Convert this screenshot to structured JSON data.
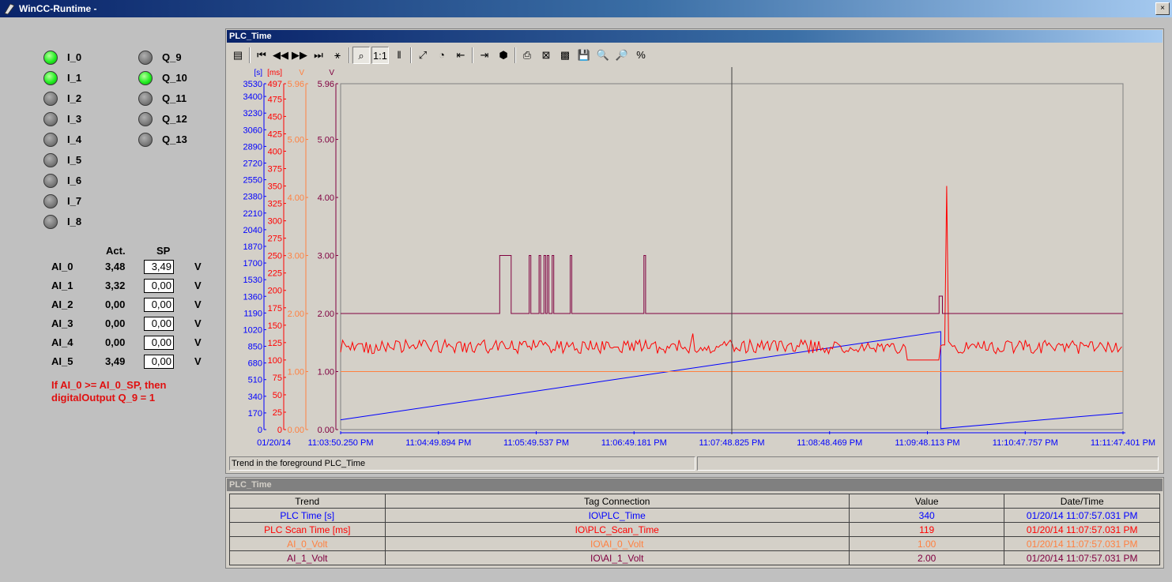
{
  "app": {
    "title": "WinCC-Runtime -"
  },
  "inputs": [
    {
      "label": "I_0",
      "state": "on"
    },
    {
      "label": "I_1",
      "state": "on"
    },
    {
      "label": "I_2",
      "state": "off"
    },
    {
      "label": "I_3",
      "state": "off"
    },
    {
      "label": "I_4",
      "state": "off"
    },
    {
      "label": "I_5",
      "state": "off"
    },
    {
      "label": "I_6",
      "state": "off"
    },
    {
      "label": "I_7",
      "state": "off"
    },
    {
      "label": "I_8",
      "state": "off"
    }
  ],
  "outputs": [
    {
      "label": "Q_9",
      "state": "off"
    },
    {
      "label": "Q_10",
      "state": "on"
    },
    {
      "label": "Q_11",
      "state": "off"
    },
    {
      "label": "Q_12",
      "state": "off"
    },
    {
      "label": "Q_13",
      "state": "off"
    }
  ],
  "analog": {
    "header_act": "Act.",
    "header_sp": "SP",
    "rows": [
      {
        "label": "AI_0",
        "act": "3,48",
        "sp": "3,49",
        "unit": "V"
      },
      {
        "label": "AI_1",
        "act": "3,32",
        "sp": "0,00",
        "unit": "V"
      },
      {
        "label": "AI_2",
        "act": "0,00",
        "sp": "0,00",
        "unit": "V"
      },
      {
        "label": "AI_3",
        "act": "0,00",
        "sp": "0,00",
        "unit": "V"
      },
      {
        "label": "AI_4",
        "act": "0,00",
        "sp": "0,00",
        "unit": "V"
      },
      {
        "label": "AI_5",
        "act": "3,49",
        "sp": "0,00",
        "unit": "V"
      }
    ],
    "note_line1": "If AI_0 >= AI_0_SP, then",
    "note_line2": "digitalOutput Q_9 = 1"
  },
  "trend_window": {
    "title": "PLC_Time",
    "status_text": "Trend in the foreground PLC_Time",
    "toolbar_icons": [
      "config-dialog-icon",
      "first-record-icon",
      "previous-record-icon",
      "next-record-icon",
      "last-record-icon",
      "start-stop-icon",
      "zoom-area-icon",
      "original-view-icon",
      "ruler-icon",
      "select-data-icon",
      "time-base-icon",
      "previous-trend-icon",
      "next-trend-icon",
      "connect-backup-icon",
      "print-icon",
      "export-icon",
      "stats-icon",
      "save-icon",
      "zoom-time-icon",
      "zoom-value-icon",
      "percent-icon"
    ],
    "toolbar_glyphs": [
      "▤",
      "⏮",
      "◀◀",
      "▶▶",
      "⏭",
      "⚹",
      "⌕",
      "1:1",
      "‖",
      "⤢",
      "◔",
      "⇤",
      "⇥",
      "⬢",
      "⎙",
      "⊠",
      "▩",
      "💾",
      "🔍",
      "🔎",
      "%"
    ],
    "date_label": "01/20/14",
    "cursor_time": "11:07:48.825 PM"
  },
  "chart_data": {
    "type": "line",
    "x_tick_labels": [
      "11:03:50.250 PM",
      "11:04:49.894 PM",
      "11:05:49.537 PM",
      "11:06:49.181 PM",
      "11:07:48.825 PM",
      "11:08:48.469 PM",
      "11:09:48.113 PM",
      "11:10:47.757 PM",
      "11:11:47.401 PM"
    ],
    "x_range_seconds": [
      0,
      477.151
    ],
    "axes": [
      {
        "unit": "[s]",
        "color": "#0000ff",
        "range": [
          0,
          3530
        ],
        "tick_labels": [
          "0",
          "170",
          "340",
          "510",
          "680",
          "850",
          "1020",
          "1190",
          "1360",
          "1530",
          "1700",
          "1870",
          "2040",
          "2210",
          "2380",
          "2550",
          "2720",
          "2890",
          "3060",
          "3230",
          "3400",
          "3530"
        ]
      },
      {
        "unit": "[ms]",
        "color": "#ff0000",
        "range": [
          0,
          497
        ],
        "tick_labels": [
          "0",
          "25",
          "50",
          "75",
          "100",
          "125",
          "150",
          "175",
          "200",
          "225",
          "250",
          "275",
          "300",
          "325",
          "350",
          "375",
          "400",
          "425",
          "450",
          "475",
          "497"
        ]
      },
      {
        "unit": "V",
        "color": "#ff8040",
        "range": [
          0,
          5.96
        ],
        "tick_labels": [
          "0.00",
          "1.00",
          "2.00",
          "3.00",
          "4.00",
          "5.00",
          "5.96"
        ]
      },
      {
        "unit": "V",
        "color": "#800040",
        "range": [
          0,
          5.96
        ],
        "tick_labels": [
          "0.00",
          "1.00",
          "2.00",
          "3.00",
          "4.00",
          "5.00",
          "5.96"
        ]
      }
    ],
    "series": [
      {
        "name": "PLC Time [s]",
        "color": "#0000ff",
        "axis": 0,
        "points": [
          [
            0,
            100
          ],
          [
            366,
            1000
          ],
          [
            366,
            10
          ],
          [
            477,
            170
          ]
        ]
      },
      {
        "name": "PLC Scan Time [ms]",
        "color": "#ff0000",
        "axis": 1,
        "baseline": 119,
        "noise": 10,
        "spikes": [
          [
            215,
            138
          ],
          [
            265,
            127
          ],
          [
            370,
            350
          ]
        ],
        "flat": [
          [
            345,
            365,
            100
          ]
        ]
      },
      {
        "name": "AI_0_Volt",
        "color": "#ff8040",
        "axis": 2,
        "points": [
          [
            0,
            1.0
          ],
          [
            477,
            1.0
          ]
        ]
      },
      {
        "name": "AI_1_Volt",
        "color": "#800040",
        "axis": 3,
        "points": [
          [
            0,
            2
          ],
          [
            97,
            2
          ],
          [
            97,
            3
          ],
          [
            104,
            3
          ],
          [
            104,
            2
          ],
          [
            115,
            2
          ],
          [
            115,
            3
          ],
          [
            116,
            3
          ],
          [
            116,
            2
          ],
          [
            121,
            2
          ],
          [
            121,
            3
          ],
          [
            122,
            3
          ],
          [
            122,
            2
          ],
          [
            124,
            2
          ],
          [
            124,
            3
          ],
          [
            125,
            3
          ],
          [
            125,
            2
          ],
          [
            126,
            2
          ],
          [
            126,
            3
          ],
          [
            127,
            3
          ],
          [
            127,
            2
          ],
          [
            129,
            2
          ],
          [
            129,
            3
          ],
          [
            130,
            3
          ],
          [
            130,
            2
          ],
          [
            140,
            2
          ],
          [
            140,
            3
          ],
          [
            141,
            3
          ],
          [
            141,
            2
          ],
          [
            185,
            2
          ],
          [
            185,
            3
          ],
          [
            186,
            3
          ],
          [
            186,
            2
          ],
          [
            365,
            2
          ],
          [
            365,
            2.3
          ],
          [
            367,
            2.3
          ],
          [
            367,
            2
          ],
          [
            477,
            2
          ]
        ]
      }
    ],
    "grid": false,
    "legend": "table-below"
  },
  "value_table": {
    "title": "PLC_Time",
    "headers": [
      "Trend",
      "Tag Connection",
      "Value",
      "Date/Time"
    ],
    "rows": [
      {
        "trend": "PLC Time [s]",
        "tag": "IO\\PLC_Time",
        "value": "340",
        "datetime": "01/20/14 11:07:57.031 PM",
        "color": "#0000ff"
      },
      {
        "trend": "PLC Scan Time [ms]",
        "tag": "IO\\PLC_Scan_Time",
        "value": "119",
        "datetime": "01/20/14 11:07:57.031 PM",
        "color": "#ff0000"
      },
      {
        "trend": "AI_0_Volt",
        "tag": "IO\\AI_0_Volt",
        "value": "1.00",
        "datetime": "01/20/14 11:07:57.031 PM",
        "color": "#ff8040"
      },
      {
        "trend": "AI_1_Volt",
        "tag": "IO\\AI_1_Volt",
        "value": "2.00",
        "datetime": "01/20/14 11:07:57.031 PM",
        "color": "#800040"
      }
    ]
  }
}
